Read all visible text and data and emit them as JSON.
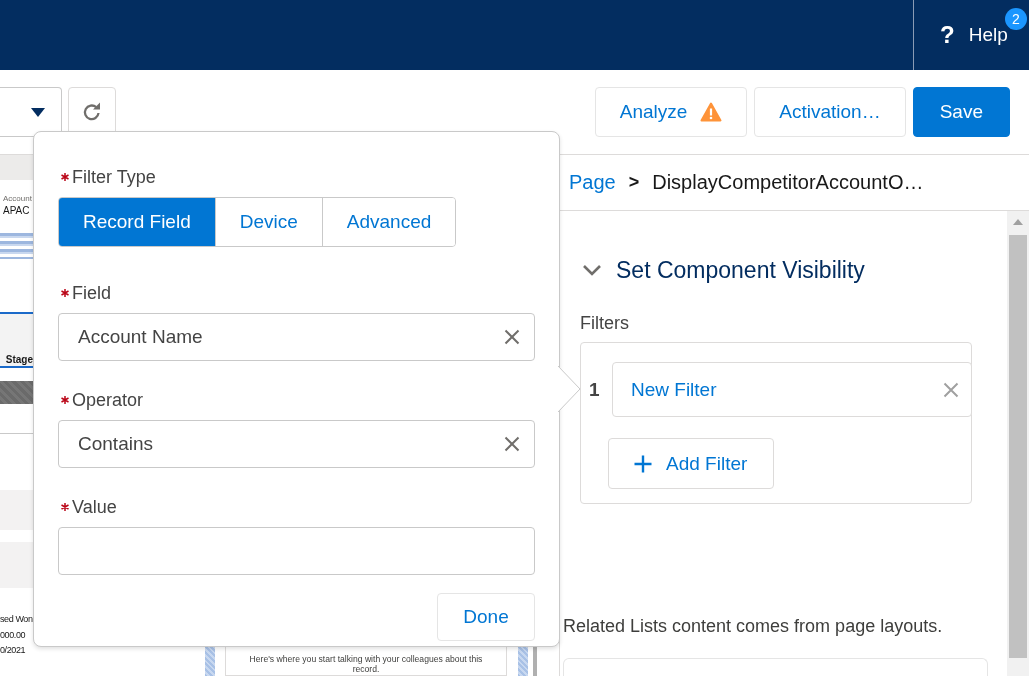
{
  "header": {
    "help": {
      "icon": "?",
      "label": "Help",
      "badge": "2"
    }
  },
  "toolbar": {
    "actions": [
      {
        "label": "Analyze",
        "kind": "neutral",
        "warning": true
      },
      {
        "label": "Activation…",
        "kind": "neutral",
        "warning": false
      },
      {
        "label": "Save",
        "kind": "brand",
        "warning": false
      }
    ]
  },
  "page_preview": {
    "account_label": "Account",
    "account_value": "APAC",
    "column_header": "Stage",
    "record_lines": [
      "sed Won",
      "000.00",
      "0/2021"
    ],
    "feed_message": "Here's where you start talking with your colleagues about this record."
  },
  "popover": {
    "filter_type": {
      "label": "Filter Type",
      "required": true,
      "options": [
        {
          "label": "Record Field",
          "selected": true
        },
        {
          "label": "Device",
          "selected": false
        },
        {
          "label": "Advanced",
          "selected": false
        }
      ]
    },
    "fields": [
      {
        "label": "Field",
        "required": true,
        "value": "Account Name",
        "clearable": true
      },
      {
        "label": "Operator",
        "required": true,
        "value": "Contains",
        "clearable": true
      },
      {
        "label": "Value",
        "required": true,
        "clearable": false
      }
    ],
    "done_button": "Done"
  },
  "properties_panel": {
    "breadcrumb": {
      "items": [
        {
          "label": "Page",
          "link": true
        },
        {
          "label": "DisplayCompetitorAccountO…",
          "link": false
        }
      ],
      "separator": ">"
    },
    "section": {
      "title": "Set Component Visibility",
      "expanded": true,
      "filters_label": "Filters",
      "filters": [
        {
          "number": "1",
          "label": "New Filter"
        }
      ],
      "add_button": "Add Filter"
    },
    "note": "Related Lists content comes from page layouts."
  }
}
